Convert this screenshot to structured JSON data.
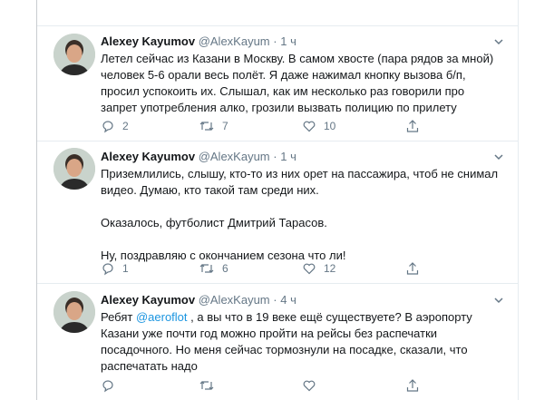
{
  "tweets": [
    {
      "author": "Alexey Kayumov",
      "handle": "@AlexKayum",
      "separator": "·",
      "time": "1 ч",
      "paragraphs": [
        "Летел сейчас из Казани в Москву. В самом хвосте (пара рядов за мной) человек 5-6 орали весь полёт. Я даже нажимал кнопку вызова б/п, просил успокоить их. Слышал, как им несколько раз говорили про запрет употребления алко, грозили вызвать полицию по прилету"
      ],
      "replies": "2",
      "retweets": "7",
      "likes": "10"
    },
    {
      "author": "Alexey Kayumov",
      "handle": "@AlexKayum",
      "separator": "·",
      "time": "1 ч",
      "paragraphs": [
        "Приземлились, слышу, кто-то из них орет на пассажира, чтоб не снимал видео. Думаю, кто такой там среди них.",
        "Оказалось, футболист Дмитрий Тарасов.",
        "Ну, поздравляю с окончанием сезона что ли!"
      ],
      "replies": "1",
      "retweets": "6",
      "likes": "12"
    },
    {
      "author": "Alexey Kayumov",
      "handle": "@AlexKayum",
      "separator": "·",
      "time": "4 ч",
      "text_before": "Ребят ",
      "mention": "@aeroflot",
      "text_after": " , а вы что в 19 веке ещё существуете? В аэропорту Казани уже почти год можно пройти на рейсы без распечатки посадочного. Но меня сейчас тормознули на посадке, сказали, что распечатать надо"
    }
  ],
  "icons": {
    "caret": "chevron-down-icon",
    "reply": "reply-icon",
    "retweet": "retweet-icon",
    "like": "heart-icon",
    "share": "share-icon"
  },
  "colors": {
    "text": "#14171a",
    "secondary": "#657786",
    "link": "#1b95e0",
    "border": "#e6ecf0"
  }
}
